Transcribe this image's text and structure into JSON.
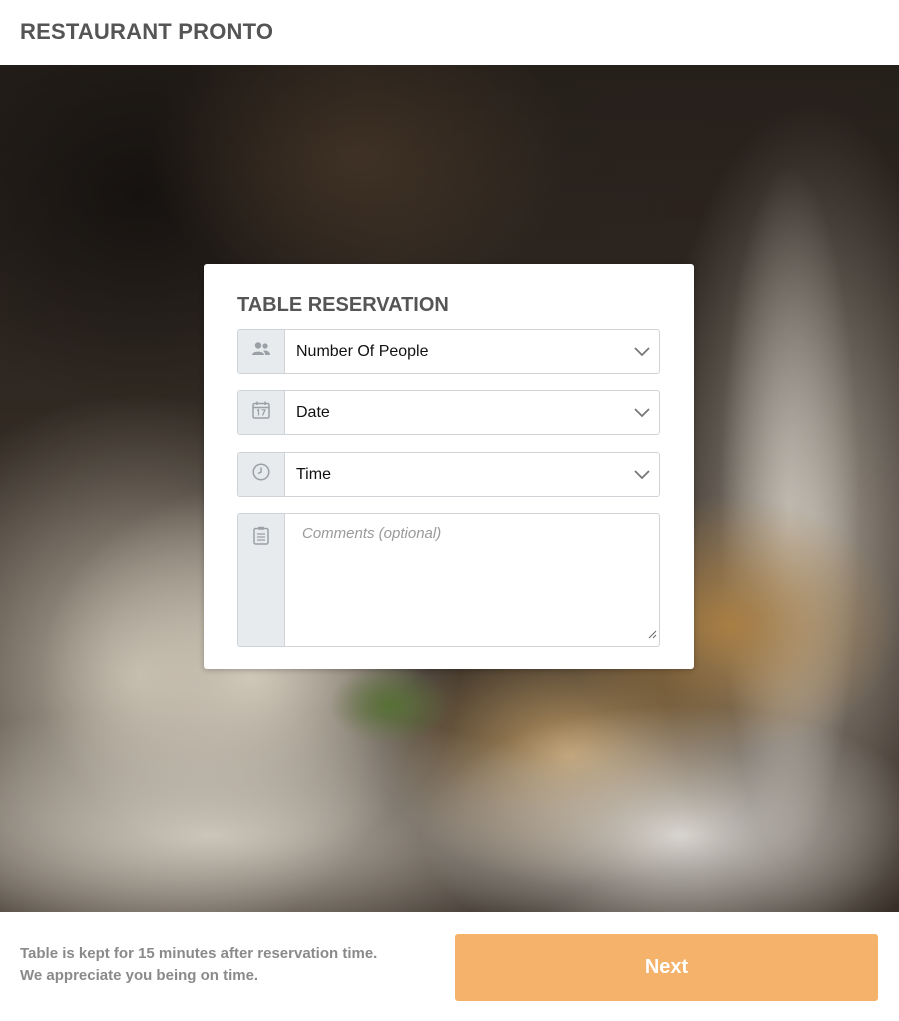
{
  "header": {
    "brand": "RESTAURANT PRONTO"
  },
  "reservation": {
    "title": "TABLE RESERVATION",
    "people": {
      "value": "Number Of People",
      "icon": "people-icon"
    },
    "date": {
      "value": "Date",
      "icon": "calendar-icon"
    },
    "time": {
      "value": "Time",
      "icon": "clock-icon"
    },
    "comments": {
      "placeholder": "Comments (optional)",
      "icon": "notepad-icon"
    }
  },
  "footer": {
    "note_line1": "Table is kept for 15 minutes after reservation time.",
    "note_line2": "We appreciate you being on time.",
    "next_label": "Next"
  },
  "colors": {
    "accent": "#f5b26a",
    "text_dark": "#555555",
    "text_muted": "#8a8a8a",
    "addon_bg": "#e8ebee"
  }
}
